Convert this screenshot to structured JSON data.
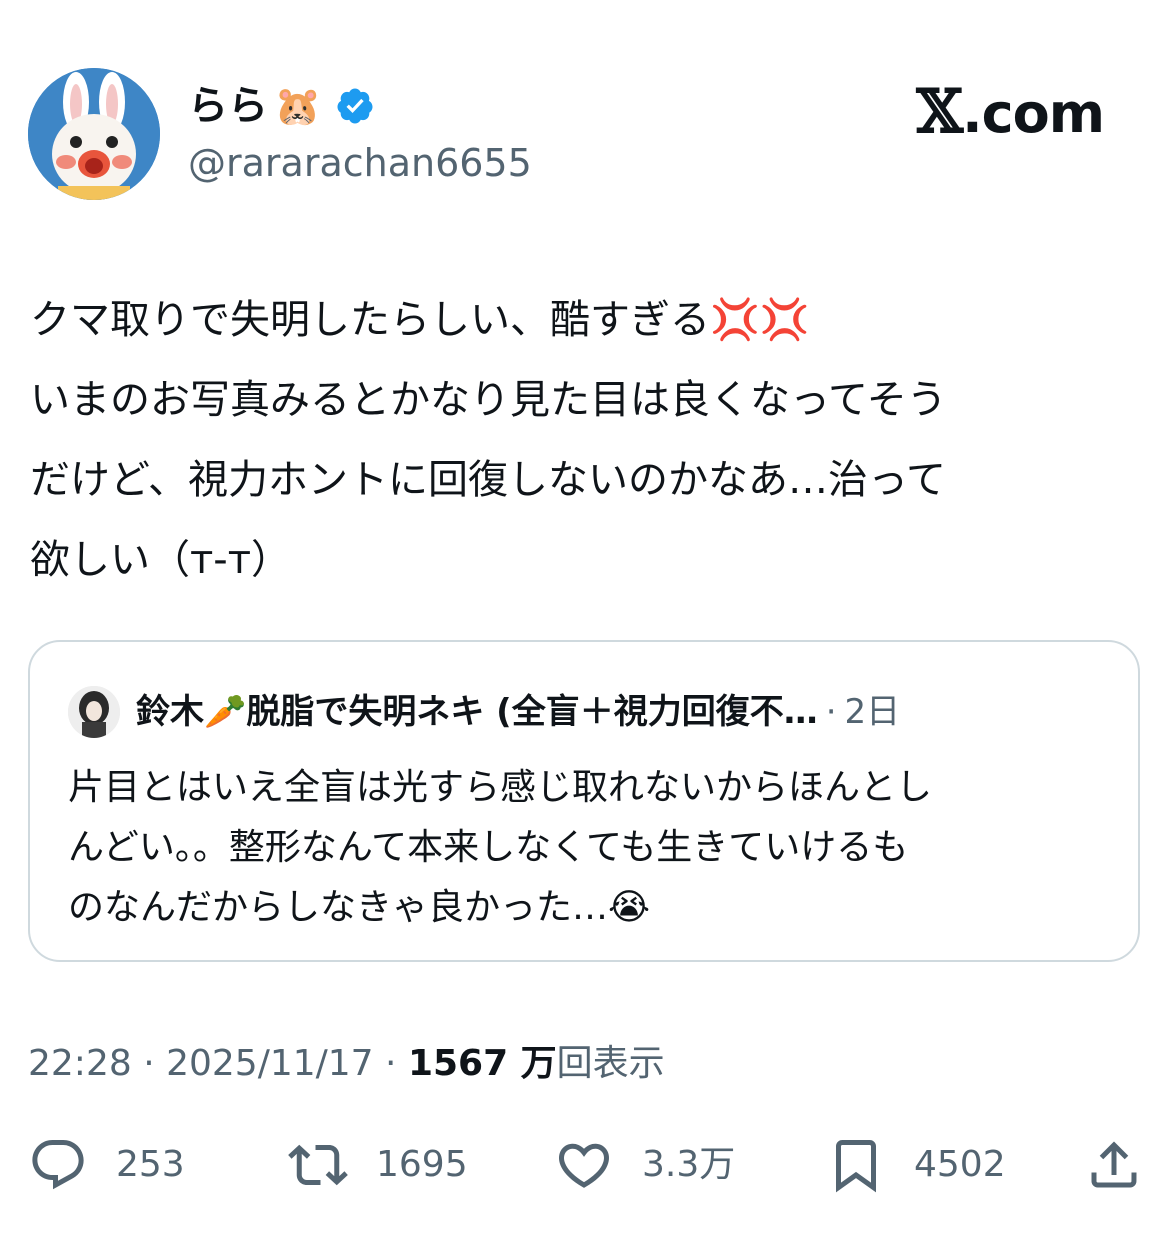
{
  "author": {
    "name": "らら",
    "name_emoji": "🐹",
    "handle": "@rarar achan6655",
    "verified": true,
    "avatar_bg": "#3e86c6"
  },
  "brand": {
    "logo_mark": "𝕏",
    "logo_text": ".com"
  },
  "tweet": {
    "text": "クマ取りで失明したらしい、酷すぎる💢💢\nいまのお写真みるとかなり見た目は良くなってそう\nだけど、視力ホントに回復しないのかなあ…治って\n欲しい（т-т）"
  },
  "quote": {
    "name": "鈴木🥕脱脂で失明ネキ (全盲＋視力回復不…",
    "separator": "·",
    "time": "2日",
    "text": "片目とはいえ全盲は光すら感じ取れないからほんとし\nんどい。。整形なんて本来しなくても生きていけるも\nのなんだからしなきゃ良かった…😭"
  },
  "meta": {
    "time": "22:28",
    "sep1": " · ",
    "date": "2025/11/17",
    "sep2": " · ",
    "views_count": "1567 万",
    "views_label": "回表示"
  },
  "actions": {
    "replies": "253",
    "retweets": "1695",
    "likes": "3.3万",
    "bookmarks": "4502"
  },
  "colors": {
    "text_primary": "#0f1419",
    "text_secondary": "#536471",
    "border": "#cfd9de",
    "verified_blue": "#1d9bf0",
    "icon_gray": "#536471"
  },
  "icons": {
    "reply": "speech-bubble-icon",
    "retweet": "retweet-arrows-icon",
    "like": "heart-icon",
    "bookmark": "bookmark-icon",
    "share": "share-upload-icon",
    "verified": "verified-badge-icon"
  }
}
